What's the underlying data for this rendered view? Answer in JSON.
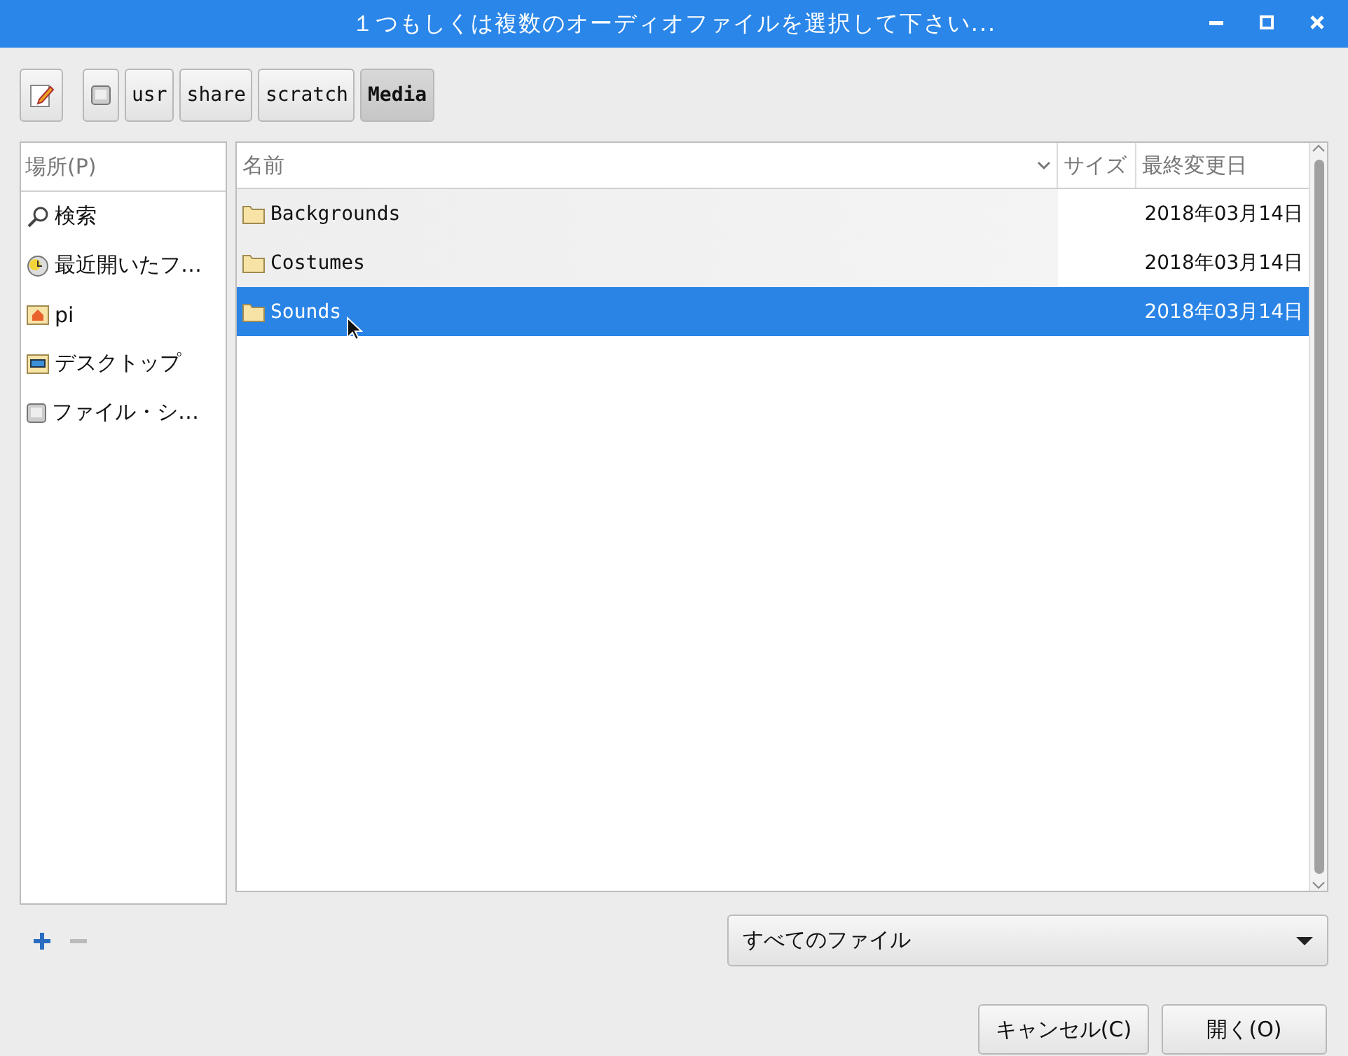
{
  "window": {
    "title": "１つもしくは複数のオーディオファイルを選択して下さい..."
  },
  "path_bar": [
    {
      "kind": "drive",
      "selected": false
    },
    {
      "kind": "folder",
      "label": "usr",
      "selected": false
    },
    {
      "kind": "folder",
      "label": "share",
      "selected": false
    },
    {
      "kind": "folder",
      "label": "scratch",
      "selected": false
    },
    {
      "kind": "folder",
      "label": "Media",
      "selected": true
    }
  ],
  "places": {
    "heading": "場所(P)",
    "items": [
      {
        "kind": "search",
        "label": "検索"
      },
      {
        "kind": "recent",
        "label": "最近開いたフ…"
      },
      {
        "kind": "home",
        "label": "pi"
      },
      {
        "kind": "desktop",
        "label": "デスクトップ"
      },
      {
        "kind": "drive",
        "label": "ファイル・シ…"
      }
    ]
  },
  "files": {
    "columns": [
      "名前",
      "サイズ",
      "最終変更日"
    ],
    "rows": [
      {
        "name": "Backgrounds",
        "modified": "2018年03月14日",
        "selected": false
      },
      {
        "name": "Costumes",
        "modified": "2018年03月14日",
        "selected": false
      },
      {
        "name": "Sounds",
        "modified": "2018年03月14日",
        "selected": true
      }
    ]
  },
  "filter": {
    "value": "すべてのファイル"
  },
  "buttons": [
    {
      "label": "キャンセル(C)"
    },
    {
      "label": "開く(O)"
    }
  ]
}
